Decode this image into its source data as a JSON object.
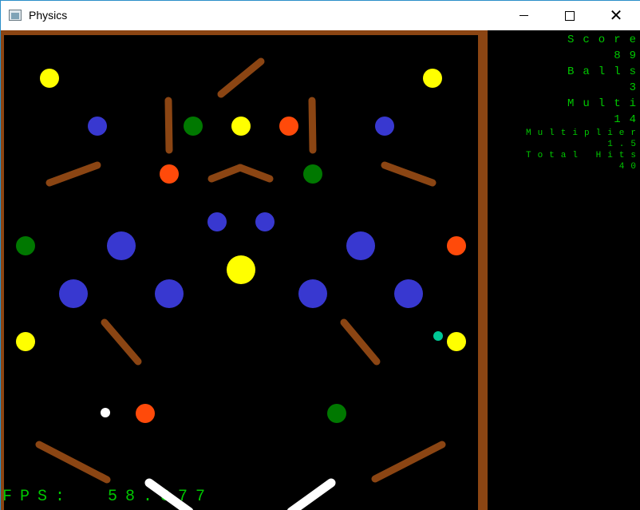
{
  "window": {
    "title": "Physics",
    "minimize_icon": "minimize-icon",
    "maximize_icon": "maximize-icon",
    "close_icon": "close-icon"
  },
  "hud": {
    "score_label": "Score",
    "score_value": "89",
    "balls_label": "Balls",
    "balls_value": "3",
    "multi_label": "Multi",
    "multi_value": "14",
    "multiplier_label": "Multiplier",
    "multiplier_value": "1.5",
    "total_hits_label": "Total Hits",
    "total_hits_value": "40"
  },
  "fps": {
    "text": "FPS:  58.377"
  },
  "colors": {
    "wall": "#8b4513",
    "paddle": "#8b4513",
    "flipper": "#ffffff",
    "yellow": "#ffff00",
    "blue": "#3838d0",
    "green": "#007800",
    "orange": "#ff4a0a",
    "ball": "#ffffff",
    "teal": "#00c896",
    "text": "#00c800"
  }
}
